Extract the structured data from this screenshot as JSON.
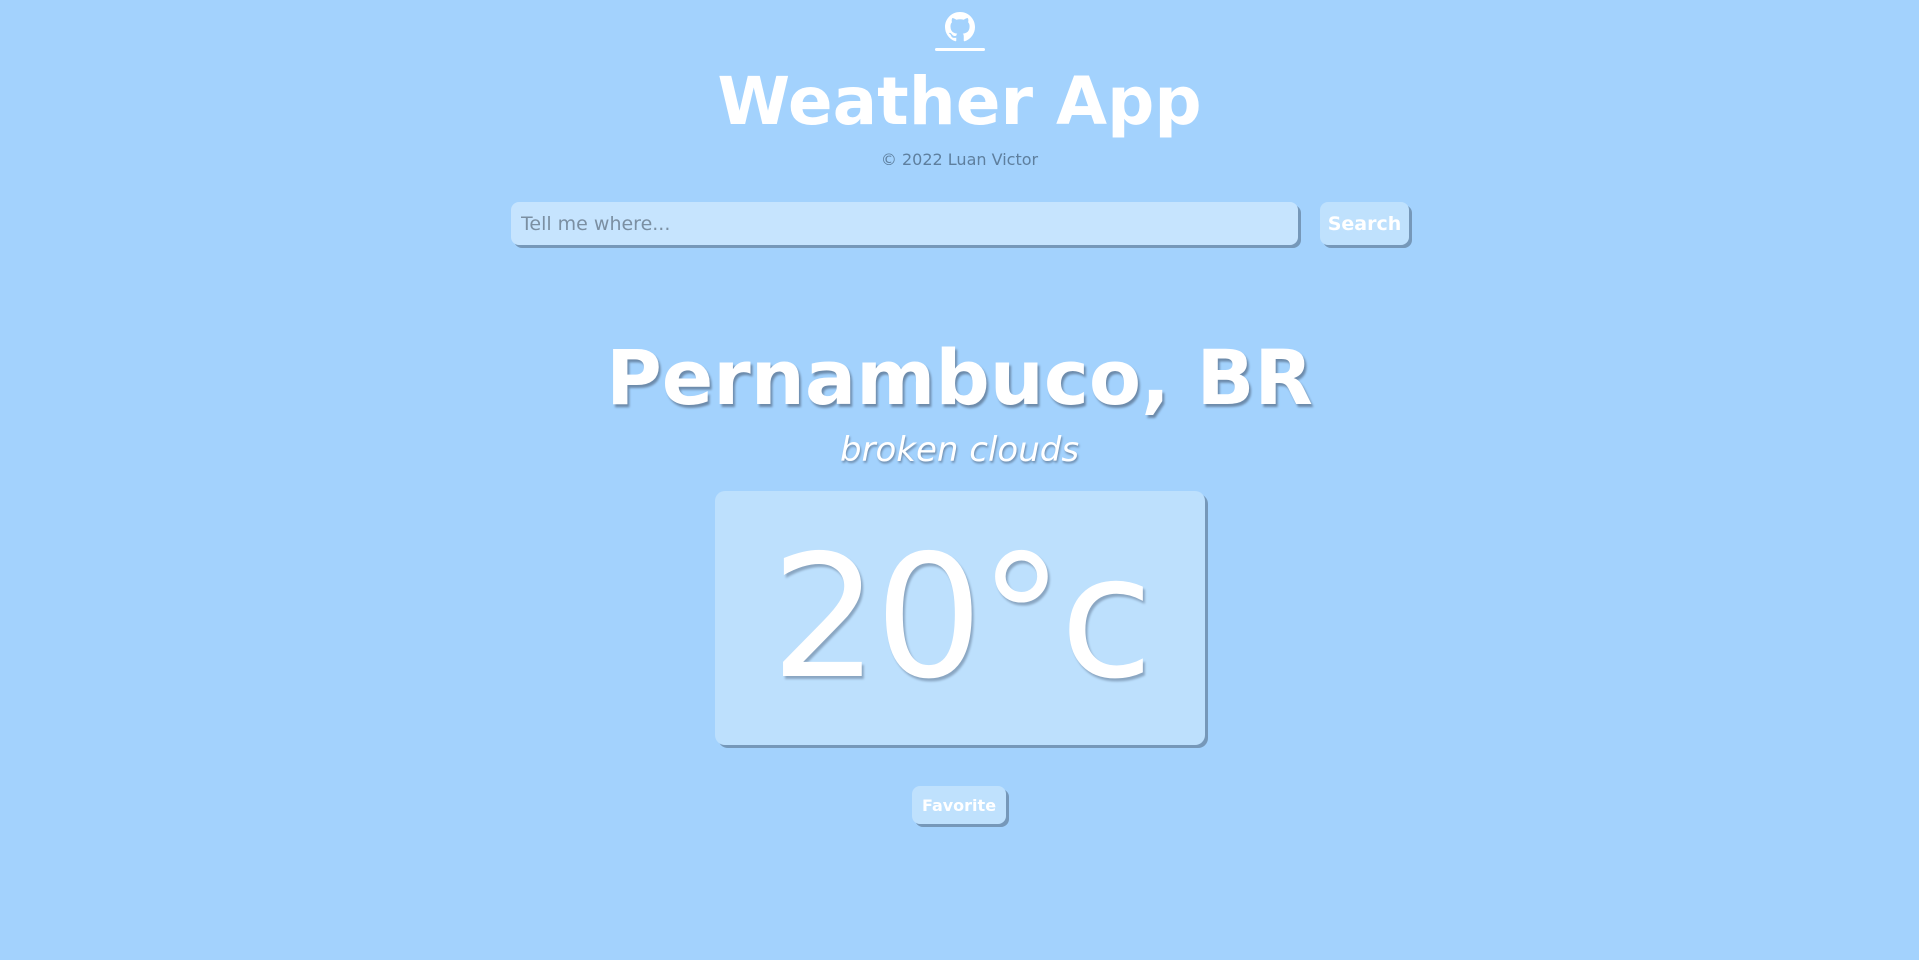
{
  "header": {
    "github_link_icon": "github-icon",
    "title": "Weather App",
    "copyright": "© 2022 Luan Victor"
  },
  "search": {
    "placeholder": "Tell me where...",
    "value": "",
    "button_label": "Search"
  },
  "weather": {
    "location": "Pernambuco, BR",
    "condition": "broken clouds",
    "temperature": "20°c"
  },
  "actions": {
    "favorite_label": "Favorite"
  },
  "colors": {
    "background": "#a3d2fd",
    "input_background": "#c6e4fe",
    "card_background": "#bde0fd",
    "shadow": "#7698b9",
    "text": "#ffffff",
    "muted_text": "#5e7f9e"
  }
}
